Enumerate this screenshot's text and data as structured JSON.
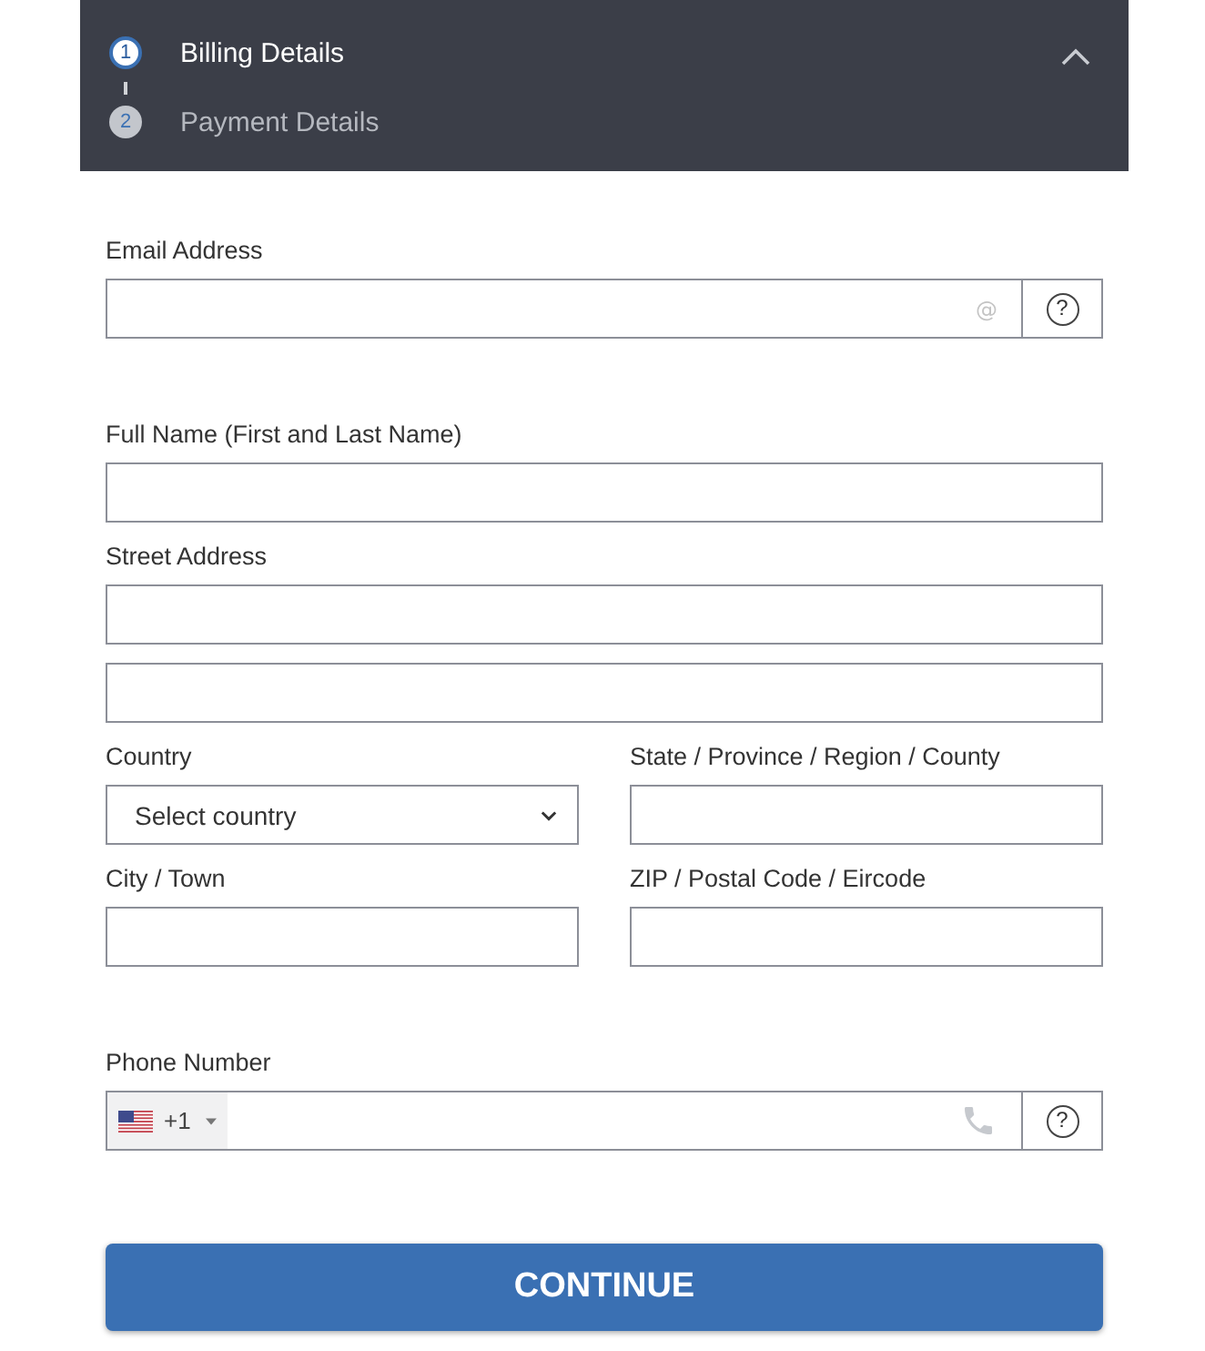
{
  "header": {
    "expanded": true,
    "steps": [
      {
        "number": "1",
        "label": "Billing Details",
        "selected": true
      },
      {
        "number": "2",
        "label": "Payment Details",
        "selected": false
      }
    ]
  },
  "sections": [
    {
      "rows": [
        {
          "fields": [
            {
              "kind": "email",
              "label": "Email Address",
              "adornment": "@",
              "help": "?"
            }
          ]
        }
      ]
    },
    {
      "rows": [
        {
          "fields": [
            {
              "kind": "text",
              "label": "Full Name (First and Last Name)"
            }
          ]
        },
        {
          "fields": [
            {
              "kind": "text",
              "label": "Street Address"
            }
          ]
        },
        {
          "fields": [
            {
              "kind": "text"
            }
          ]
        },
        {
          "fields": [
            {
              "kind": "select",
              "label": "Country",
              "placeholder": "Select country"
            },
            {
              "kind": "text",
              "label": "State / Province / Region / County"
            }
          ]
        },
        {
          "fields": [
            {
              "kind": "text",
              "label": "City / Town"
            },
            {
              "kind": "text",
              "label": "ZIP / Postal Code / Eircode"
            }
          ]
        }
      ]
    },
    {
      "rows": [
        {
          "fields": [
            {
              "kind": "phone",
              "label": "Phone Number",
              "country_code": "+1",
              "help": "?"
            }
          ]
        }
      ]
    }
  ],
  "continue_button": {
    "label": "CONTINUE"
  }
}
